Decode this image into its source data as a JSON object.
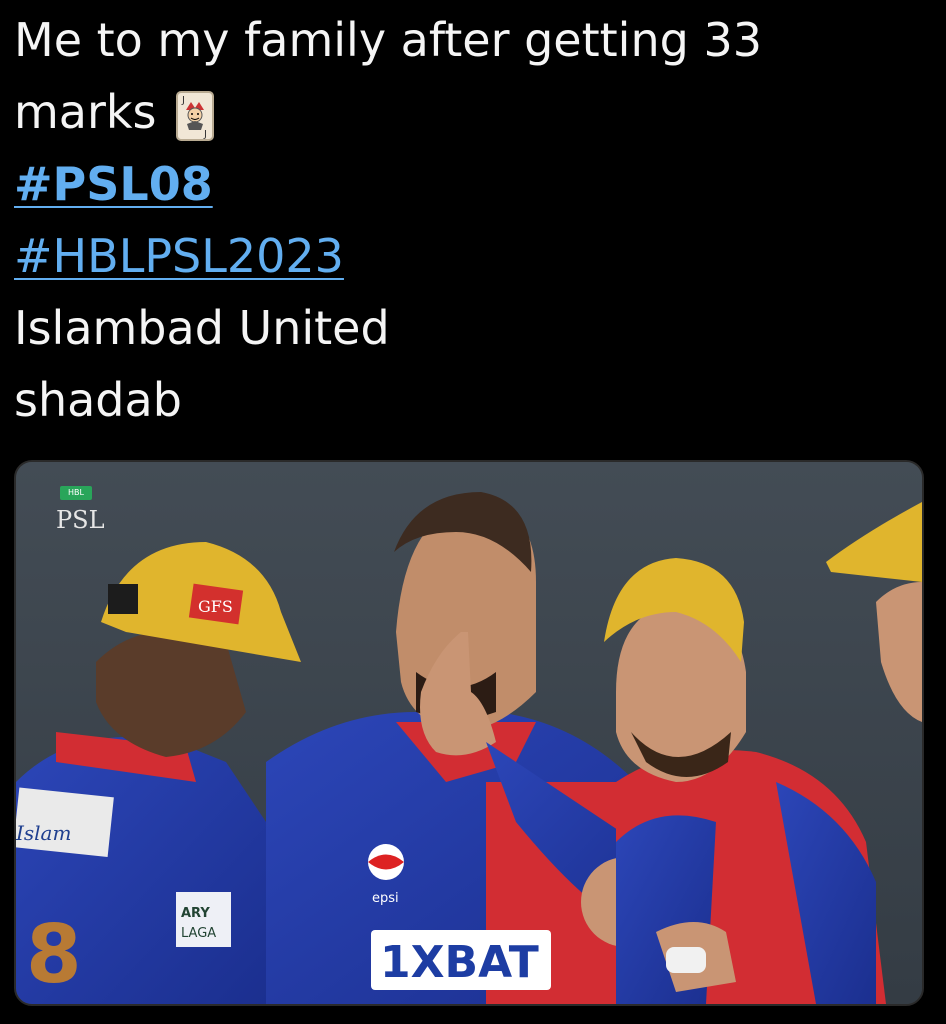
{
  "tweet": {
    "line1": "Me to my family after getting 33",
    "line2": "marks",
    "emoji": "joker-card",
    "hashtag1": "#PSL08",
    "hashtag2": "#HBLPSL2023",
    "line5": "Islambad United",
    "line6": "shadab"
  },
  "media": {
    "broadcast_logo": "PSL",
    "hbl_label": "HBL",
    "sponsor_shirt": "1XBAT",
    "cap_badge": "GFS",
    "sponsor_sleeve": "ARY LAGA",
    "chest_logo": "epsi",
    "left_back_text": "Islam"
  },
  "colors": {
    "background": "#000000",
    "text": "#f5f5f5",
    "hashtag": "#62aef0"
  }
}
